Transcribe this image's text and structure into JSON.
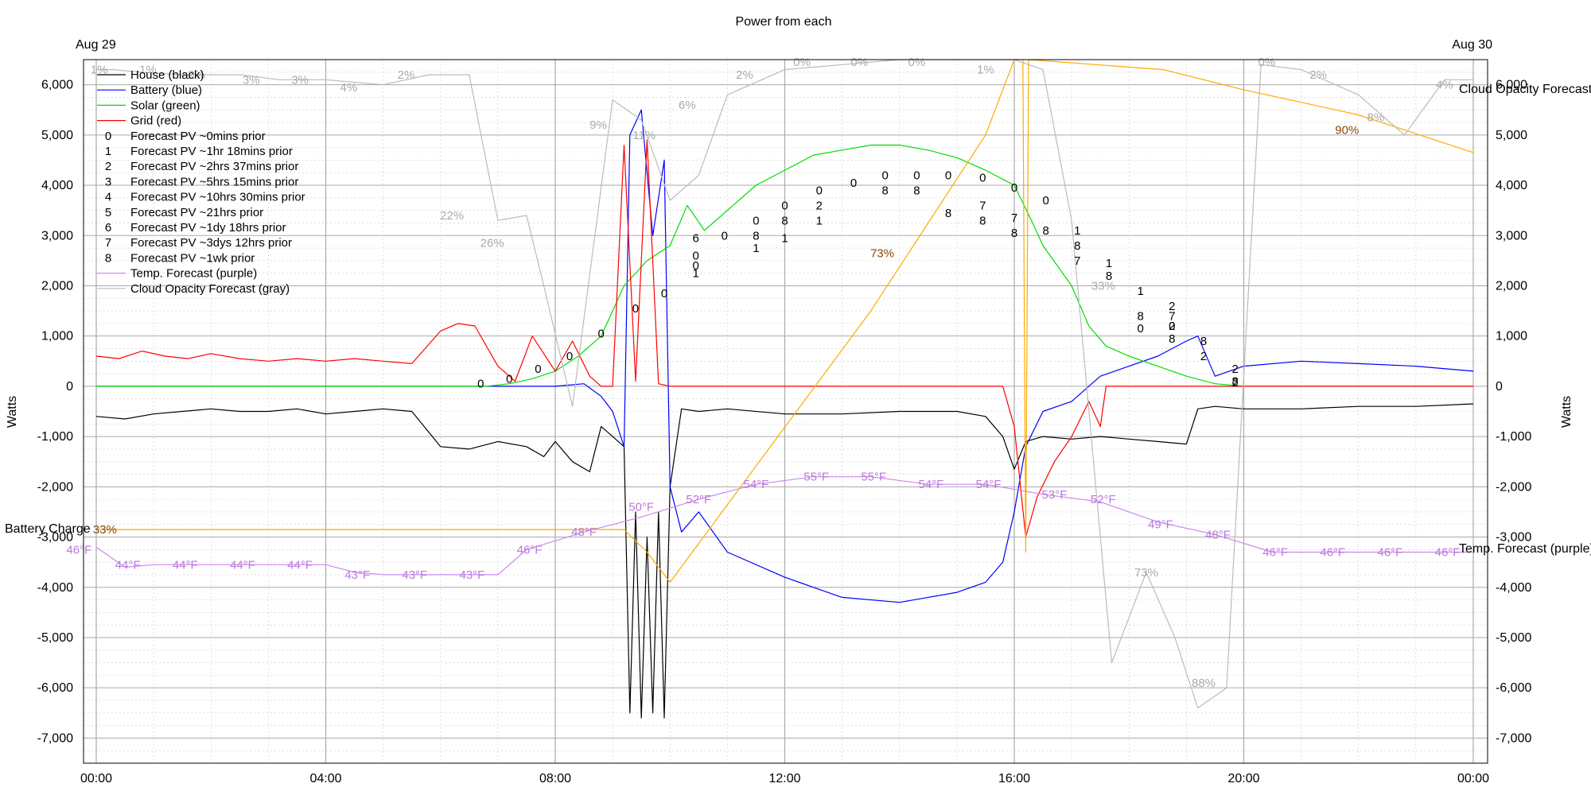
{
  "chart_data": {
    "type": "line",
    "title": "Power from each",
    "date_left": "Aug 29",
    "date_right": "Aug 30",
    "ylabel_left": "Watts",
    "ylabel_right": "Watts",
    "label_battery_charge": "Battery Charge",
    "label_cloud_forecast": "Cloud Opacity Forecast",
    "label_temp_forecast": "Temp. Forecast (purple)",
    "xlim_hours": [
      0,
      24
    ],
    "ylim": [
      -7500,
      6500
    ],
    "x_tick_labels": [
      "00:00",
      "04:00",
      "08:00",
      "12:00",
      "16:00",
      "20:00",
      "00:00"
    ],
    "y_tick_values": [
      6000,
      5000,
      4000,
      3000,
      2000,
      1000,
      0,
      -1000,
      -2000,
      -3000,
      -4000,
      -5000,
      -6000,
      -7000
    ],
    "y_tick_labels": [
      "6,000",
      "5,000",
      "4,000",
      "3,000",
      "2,000",
      "1,000",
      "0",
      "-1,000",
      "-2,000",
      "-3,000",
      "-4,000",
      "-5,000",
      "-6,000",
      "-7,000"
    ],
    "grid": true,
    "legend_position": "top-left",
    "legend": [
      {
        "marker": "line",
        "color": "#000000",
        "label": "House (black)"
      },
      {
        "marker": "line",
        "color": "#0000ff",
        "label": "Battery (blue)"
      },
      {
        "marker": "line",
        "color": "#00dd00",
        "label": "Solar (green)"
      },
      {
        "marker": "line",
        "color": "#ff0000",
        "label": "Grid (red)"
      },
      {
        "marker": "0",
        "label": "Forecast PV ~0mins prior"
      },
      {
        "marker": "1",
        "label": "Forecast PV ~1hr 18mins prior"
      },
      {
        "marker": "2",
        "label": "Forecast PV ~2hrs 37mins prior"
      },
      {
        "marker": "3",
        "label": "Forecast PV ~5hrs 15mins prior"
      },
      {
        "marker": "4",
        "label": "Forecast PV ~10hrs 30mins prior"
      },
      {
        "marker": "5",
        "label": "Forecast PV ~21hrs prior"
      },
      {
        "marker": "6",
        "label": "Forecast PV ~1dy 18hrs prior"
      },
      {
        "marker": "7",
        "label": "Forecast PV ~3dys 12hrs prior"
      },
      {
        "marker": "8",
        "label": "Forecast PV ~1wk prior"
      },
      {
        "marker": "line",
        "color": "#cc88ee",
        "label": "Temp. Forecast (purple)"
      },
      {
        "marker": "line",
        "color": "#bbbbbb",
        "label": "Cloud Opacity Forecast (gray)"
      }
    ],
    "series": [
      {
        "name": "House (black)",
        "color": "#000000",
        "x": [
          0,
          0.5,
          1,
          1.5,
          2,
          2.5,
          3,
          3.5,
          4,
          4.5,
          5,
          5.5,
          6,
          6.5,
          7,
          7.5,
          7.8,
          8,
          8.3,
          8.6,
          8.8,
          9.0,
          9.2,
          9.3,
          9.4,
          9.5,
          9.6,
          9.7,
          9.8,
          9.9,
          10.0,
          10.2,
          10.5,
          11,
          12,
          13,
          14,
          15,
          15.5,
          15.8,
          16.0,
          16.2,
          16.5,
          17,
          17.5,
          18,
          18.5,
          19.0,
          19.2,
          19.5,
          20,
          21,
          22,
          23,
          24
        ],
        "y": [
          -600,
          -650,
          -550,
          -500,
          -450,
          -500,
          -500,
          -450,
          -550,
          -500,
          -450,
          -500,
          -1200,
          -1250,
          -1100,
          -1200,
          -1400,
          -1100,
          -1500,
          -1700,
          -800,
          -1000,
          -1200,
          -6500,
          -2500,
          -6600,
          -3000,
          -6500,
          -2500,
          -6600,
          -2000,
          -450,
          -500,
          -450,
          -550,
          -550,
          -500,
          -500,
          -600,
          -1000,
          -1650,
          -1100,
          -1000,
          -1050,
          -1000,
          -1050,
          -1100,
          -1150,
          -450,
          -400,
          -450,
          -450,
          -400,
          -400,
          -350
        ]
      },
      {
        "name": "Battery (blue)",
        "color": "#0000ff",
        "x": [
          0,
          1,
          2,
          3,
          4,
          5,
          6,
          7,
          8,
          8.5,
          8.8,
          9.0,
          9.2,
          9.3,
          9.5,
          9.7,
          9.9,
          10.0,
          10.2,
          10.5,
          11,
          12,
          13,
          14,
          15,
          15.5,
          15.8,
          16.0,
          16.2,
          16.5,
          17,
          17.5,
          18,
          18.5,
          19.0,
          19.2,
          19.5,
          20,
          21,
          22,
          23,
          24
        ],
        "y": [
          0,
          0,
          0,
          0,
          0,
          0,
          0,
          0,
          0,
          50,
          -200,
          -500,
          -1200,
          5000,
          5500,
          3000,
          4500,
          -2000,
          -2900,
          -2500,
          -3300,
          -3800,
          -4200,
          -4300,
          -4100,
          -3900,
          -3500,
          -2500,
          -1200,
          -500,
          -300,
          200,
          400,
          600,
          900,
          1000,
          200,
          400,
          500,
          450,
          400,
          300
        ]
      },
      {
        "name": "Solar (green)",
        "color": "#00dd00",
        "x": [
          0,
          1,
          2,
          3,
          4,
          5,
          6,
          6.8,
          7.2,
          7.6,
          8,
          8.4,
          8.8,
          9.2,
          9.6,
          10.0,
          10.3,
          10.6,
          11,
          11.5,
          12,
          12.5,
          13,
          13.5,
          14,
          14.5,
          15,
          15.5,
          16.0,
          16.3,
          16.5,
          17.0,
          17.3,
          17.6,
          18,
          18.5,
          19.0,
          19.5,
          20,
          21,
          22,
          23,
          24
        ],
        "y": [
          0,
          0,
          0,
          0,
          0,
          0,
          0,
          0,
          50,
          150,
          300,
          600,
          1000,
          2000,
          2500,
          2800,
          3600,
          3100,
          3500,
          4000,
          4300,
          4600,
          4700,
          4800,
          4800,
          4700,
          4550,
          4300,
          4000,
          3300,
          2800,
          2000,
          1200,
          800,
          600,
          400,
          200,
          50,
          0,
          0,
          0,
          0,
          0
        ]
      },
      {
        "name": "Grid (red)",
        "color": "#ff0000",
        "x": [
          0,
          0.4,
          0.8,
          1.2,
          1.6,
          2,
          2.5,
          3,
          3.5,
          4,
          4.5,
          5,
          5.5,
          6,
          6.3,
          6.6,
          7.0,
          7.3,
          7.6,
          8.0,
          8.3,
          8.6,
          8.8,
          9.0,
          9.2,
          9.4,
          9.6,
          9.8,
          10.0,
          11,
          12,
          13,
          14,
          15,
          15.8,
          16.0,
          16.2,
          16.4,
          16.7,
          17.0,
          17.3,
          17.5,
          17.6,
          18,
          19,
          20,
          21,
          22,
          23,
          24
        ],
        "y": [
          600,
          550,
          700,
          600,
          550,
          650,
          550,
          500,
          550,
          500,
          550,
          500,
          450,
          1100,
          1250,
          1200,
          400,
          100,
          1000,
          300,
          900,
          200,
          0,
          0,
          4800,
          100,
          4900,
          50,
          0,
          0,
          0,
          0,
          0,
          0,
          0,
          -800,
          -3000,
          -2200,
          -1500,
          -1000,
          -300,
          -800,
          0,
          0,
          0,
          0,
          0,
          0,
          0,
          0
        ]
      },
      {
        "name": "Temp. Forecast (purple)",
        "color": "#cc88ee",
        "x": [
          0,
          0.5,
          1,
          2,
          3,
          4,
          4.5,
          5,
          6,
          7,
          7.5,
          8.5,
          9.5,
          10.5,
          11.5,
          12.5,
          13.5,
          14.5,
          15.5,
          16.5,
          17.5,
          18.5,
          19.5,
          20.5,
          21.5,
          22.5,
          23.5,
          24
        ],
        "y": [
          -3200,
          -3600,
          -3550,
          -3550,
          -3550,
          -3550,
          -3700,
          -3750,
          -3750,
          -3750,
          -3250,
          -2900,
          -2600,
          -2250,
          -1950,
          -1800,
          -1800,
          -1950,
          -1950,
          -2150,
          -2300,
          -2700,
          -2950,
          -3300,
          -3300,
          -3300,
          -3300,
          -3300
        ]
      },
      {
        "name": "Battery Charge",
        "color": "#ffaa00",
        "x": [
          0,
          9.2,
          9.6,
          10.0,
          13.5,
          15.5,
          16.0,
          16.15,
          16.2,
          16.25,
          18.6,
          20,
          22,
          24
        ],
        "y": [
          -2850,
          -2850,
          -3300,
          -3900,
          1500,
          5000,
          6500,
          6500,
          -3300,
          6500,
          6300,
          5900,
          5400,
          4650
        ]
      },
      {
        "name": "Cloud Opacity Forecast (gray)",
        "color": "#bbbbbb",
        "x": [
          0,
          0.3,
          0.8,
          1.5,
          2.5,
          3.2,
          4,
          5,
          5.8,
          6.5,
          7,
          7.5,
          7.8,
          8.3,
          9.0,
          9.5,
          10.0,
          10.5,
          11,
          12,
          13,
          14,
          15,
          16.0,
          16.5,
          17.0,
          17.7,
          18.3,
          18.8,
          19.2,
          19.7,
          20.3,
          21,
          22,
          22.8,
          23.5,
          24
        ],
        "y": [
          6300,
          6300,
          6250,
          6200,
          6200,
          6100,
          6100,
          6000,
          6200,
          6200,
          3300,
          3400,
          2000,
          -400,
          5700,
          5300,
          3700,
          4200,
          5800,
          6300,
          6400,
          6500,
          6500,
          6500,
          6300,
          3300,
          -5500,
          -3700,
          -5000,
          -6400,
          -6000,
          6400,
          6300,
          5800,
          5000,
          6100,
          6100
        ]
      }
    ],
    "forecast_markers": [
      {
        "x": 6.7,
        "y": 50,
        "label": "0"
      },
      {
        "x": 7.2,
        "y": 150,
        "label": "0"
      },
      {
        "x": 7.7,
        "y": 350,
        "label": "0"
      },
      {
        "x": 8.25,
        "y": 600,
        "label": "0"
      },
      {
        "x": 8.8,
        "y": 1050,
        "label": "0"
      },
      {
        "x": 9.4,
        "y": 1550,
        "label": "0"
      },
      {
        "x": 9.9,
        "y": 1850,
        "label": "0"
      },
      {
        "x": 10.45,
        "y": 2400,
        "label": "0"
      },
      {
        "x": 10.95,
        "y": 3000,
        "label": "0"
      },
      {
        "x": 11.5,
        "y": 3300,
        "label": "0"
      },
      {
        "x": 12.0,
        "y": 3600,
        "label": "0"
      },
      {
        "x": 12.6,
        "y": 3900,
        "label": "0"
      },
      {
        "x": 13.2,
        "y": 4050,
        "label": "0"
      },
      {
        "x": 13.75,
        "y": 4200,
        "label": "0"
      },
      {
        "x": 14.3,
        "y": 4200,
        "label": "0"
      },
      {
        "x": 14.85,
        "y": 4200,
        "label": "0"
      },
      {
        "x": 15.45,
        "y": 4150,
        "label": "0"
      },
      {
        "x": 16.0,
        "y": 3950,
        "label": "0"
      },
      {
        "x": 16.55,
        "y": 3700,
        "label": "0"
      },
      {
        "x": 17.1,
        "y": 3100,
        "label": "1"
      },
      {
        "x": 17.65,
        "y": 2450,
        "label": "1"
      },
      {
        "x": 18.2,
        "y": 1900,
        "label": "1"
      },
      {
        "x": 18.75,
        "y": 1200,
        "label": "2"
      },
      {
        "x": 19.3,
        "y": 600,
        "label": "2"
      },
      {
        "x": 19.85,
        "y": 80,
        "label": "2"
      },
      {
        "x": 10.45,
        "y": 2950,
        "label": "6"
      },
      {
        "x": 10.45,
        "y": 2600,
        "label": "0"
      },
      {
        "x": 10.45,
        "y": 2250,
        "label": "1"
      },
      {
        "x": 11.5,
        "y": 3000,
        "label": "8"
      },
      {
        "x": 11.5,
        "y": 2750,
        "label": "1"
      },
      {
        "x": 12.0,
        "y": 3300,
        "label": "8"
      },
      {
        "x": 12.0,
        "y": 2950,
        "label": "1"
      },
      {
        "x": 12.6,
        "y": 3600,
        "label": "2"
      },
      {
        "x": 12.6,
        "y": 3300,
        "label": "1"
      },
      {
        "x": 13.75,
        "y": 3900,
        "label": "8"
      },
      {
        "x": 14.3,
        "y": 3900,
        "label": "8"
      },
      {
        "x": 14.85,
        "y": 3450,
        "label": "8"
      },
      {
        "x": 15.45,
        "y": 3600,
        "label": "7"
      },
      {
        "x": 15.45,
        "y": 3300,
        "label": "8"
      },
      {
        "x": 16.0,
        "y": 3350,
        "label": "7"
      },
      {
        "x": 16.0,
        "y": 3050,
        "label": "8"
      },
      {
        "x": 16.55,
        "y": 3100,
        "label": "8"
      },
      {
        "x": 17.1,
        "y": 2800,
        "label": "8"
      },
      {
        "x": 17.1,
        "y": 2500,
        "label": "7"
      },
      {
        "x": 17.65,
        "y": 2200,
        "label": "8"
      },
      {
        "x": 18.2,
        "y": 1400,
        "label": "8"
      },
      {
        "x": 18.2,
        "y": 1150,
        "label": "0"
      },
      {
        "x": 18.75,
        "y": 1600,
        "label": "2"
      },
      {
        "x": 18.75,
        "y": 1400,
        "label": "7"
      },
      {
        "x": 18.75,
        "y": 1200,
        "label": "0"
      },
      {
        "x": 18.75,
        "y": 950,
        "label": "8"
      },
      {
        "x": 19.3,
        "y": 900,
        "label": "8"
      },
      {
        "x": 19.85,
        "y": 350,
        "label": "2"
      },
      {
        "x": 19.85,
        "y": 100,
        "label": "8"
      }
    ],
    "cloud_labels": [
      {
        "x": 0.05,
        "y": 6300,
        "text": "1%"
      },
      {
        "x": 0.9,
        "y": 6300,
        "text": "1%"
      },
      {
        "x": 1.75,
        "y": 6200,
        "text": "2%"
      },
      {
        "x": 2.7,
        "y": 6100,
        "text": "3%"
      },
      {
        "x": 3.55,
        "y": 6100,
        "text": "3%"
      },
      {
        "x": 4.4,
        "y": 5950,
        "text": "4%"
      },
      {
        "x": 5.4,
        "y": 6200,
        "text": "2%"
      },
      {
        "x": 6.2,
        "y": 3400,
        "text": "22%"
      },
      {
        "x": 6.9,
        "y": 2850,
        "text": "26%"
      },
      {
        "x": 8.75,
        "y": 5200,
        "text": "9%"
      },
      {
        "x": 9.55,
        "y": 5000,
        "text": "11%"
      },
      {
        "x": 10.3,
        "y": 5600,
        "text": "6%"
      },
      {
        "x": 11.3,
        "y": 6200,
        "text": "2%"
      },
      {
        "x": 12.3,
        "y": 6450,
        "text": "0%"
      },
      {
        "x": 13.3,
        "y": 6450,
        "text": "0%"
      },
      {
        "x": 14.3,
        "y": 6450,
        "text": "0%"
      },
      {
        "x": 15.5,
        "y": 6300,
        "text": "1%"
      },
      {
        "x": 17.55,
        "y": 2000,
        "text": "33%"
      },
      {
        "x": 18.3,
        "y": -3700,
        "text": "73%"
      },
      {
        "x": 19.3,
        "y": -5900,
        "text": "88%"
      },
      {
        "x": 20.4,
        "y": 6450,
        "text": "0%"
      },
      {
        "x": 21.3,
        "y": 6200,
        "text": "2%"
      },
      {
        "x": 22.3,
        "y": 5350,
        "text": "8%"
      },
      {
        "x": 23.5,
        "y": 6000,
        "text": "4%"
      }
    ],
    "battery_labels": [
      {
        "x": 0.15,
        "y": -2850,
        "text": "33%"
      },
      {
        "x": 13.7,
        "y": 2650,
        "text": "73%"
      },
      {
        "x": 21.8,
        "y": 5100,
        "text": "90%"
      }
    ],
    "temp_labels": [
      {
        "x": -0.3,
        "y": -3250,
        "text": "46°F"
      },
      {
        "x": 0.55,
        "y": -3550,
        "text": "44°F"
      },
      {
        "x": 1.55,
        "y": -3550,
        "text": "44°F"
      },
      {
        "x": 2.55,
        "y": -3550,
        "text": "44°F"
      },
      {
        "x": 3.55,
        "y": -3550,
        "text": "44°F"
      },
      {
        "x": 4.55,
        "y": -3750,
        "text": "43°F"
      },
      {
        "x": 5.55,
        "y": -3750,
        "text": "43°F"
      },
      {
        "x": 6.55,
        "y": -3750,
        "text": "43°F"
      },
      {
        "x": 7.55,
        "y": -3250,
        "text": "46°F"
      },
      {
        "x": 8.5,
        "y": -2900,
        "text": "48°F"
      },
      {
        "x": 9.5,
        "y": -2400,
        "text": "50°F"
      },
      {
        "x": 10.5,
        "y": -2250,
        "text": "52°F"
      },
      {
        "x": 11.5,
        "y": -1950,
        "text": "54°F"
      },
      {
        "x": 12.55,
        "y": -1800,
        "text": "55°F"
      },
      {
        "x": 13.55,
        "y": -1800,
        "text": "55°F"
      },
      {
        "x": 14.55,
        "y": -1950,
        "text": "54°F"
      },
      {
        "x": 15.55,
        "y": -1950,
        "text": "54°F"
      },
      {
        "x": 16.7,
        "y": -2150,
        "text": "53°F"
      },
      {
        "x": 17.55,
        "y": -2250,
        "text": "52°F"
      },
      {
        "x": 18.55,
        "y": -2750,
        "text": "49°F"
      },
      {
        "x": 19.55,
        "y": -2950,
        "text": "48°F"
      },
      {
        "x": 20.55,
        "y": -3300,
        "text": "46°F"
      },
      {
        "x": 21.55,
        "y": -3300,
        "text": "46°F"
      },
      {
        "x": 22.55,
        "y": -3300,
        "text": "46°F"
      },
      {
        "x": 23.55,
        "y": -3300,
        "text": "46°F"
      }
    ]
  }
}
